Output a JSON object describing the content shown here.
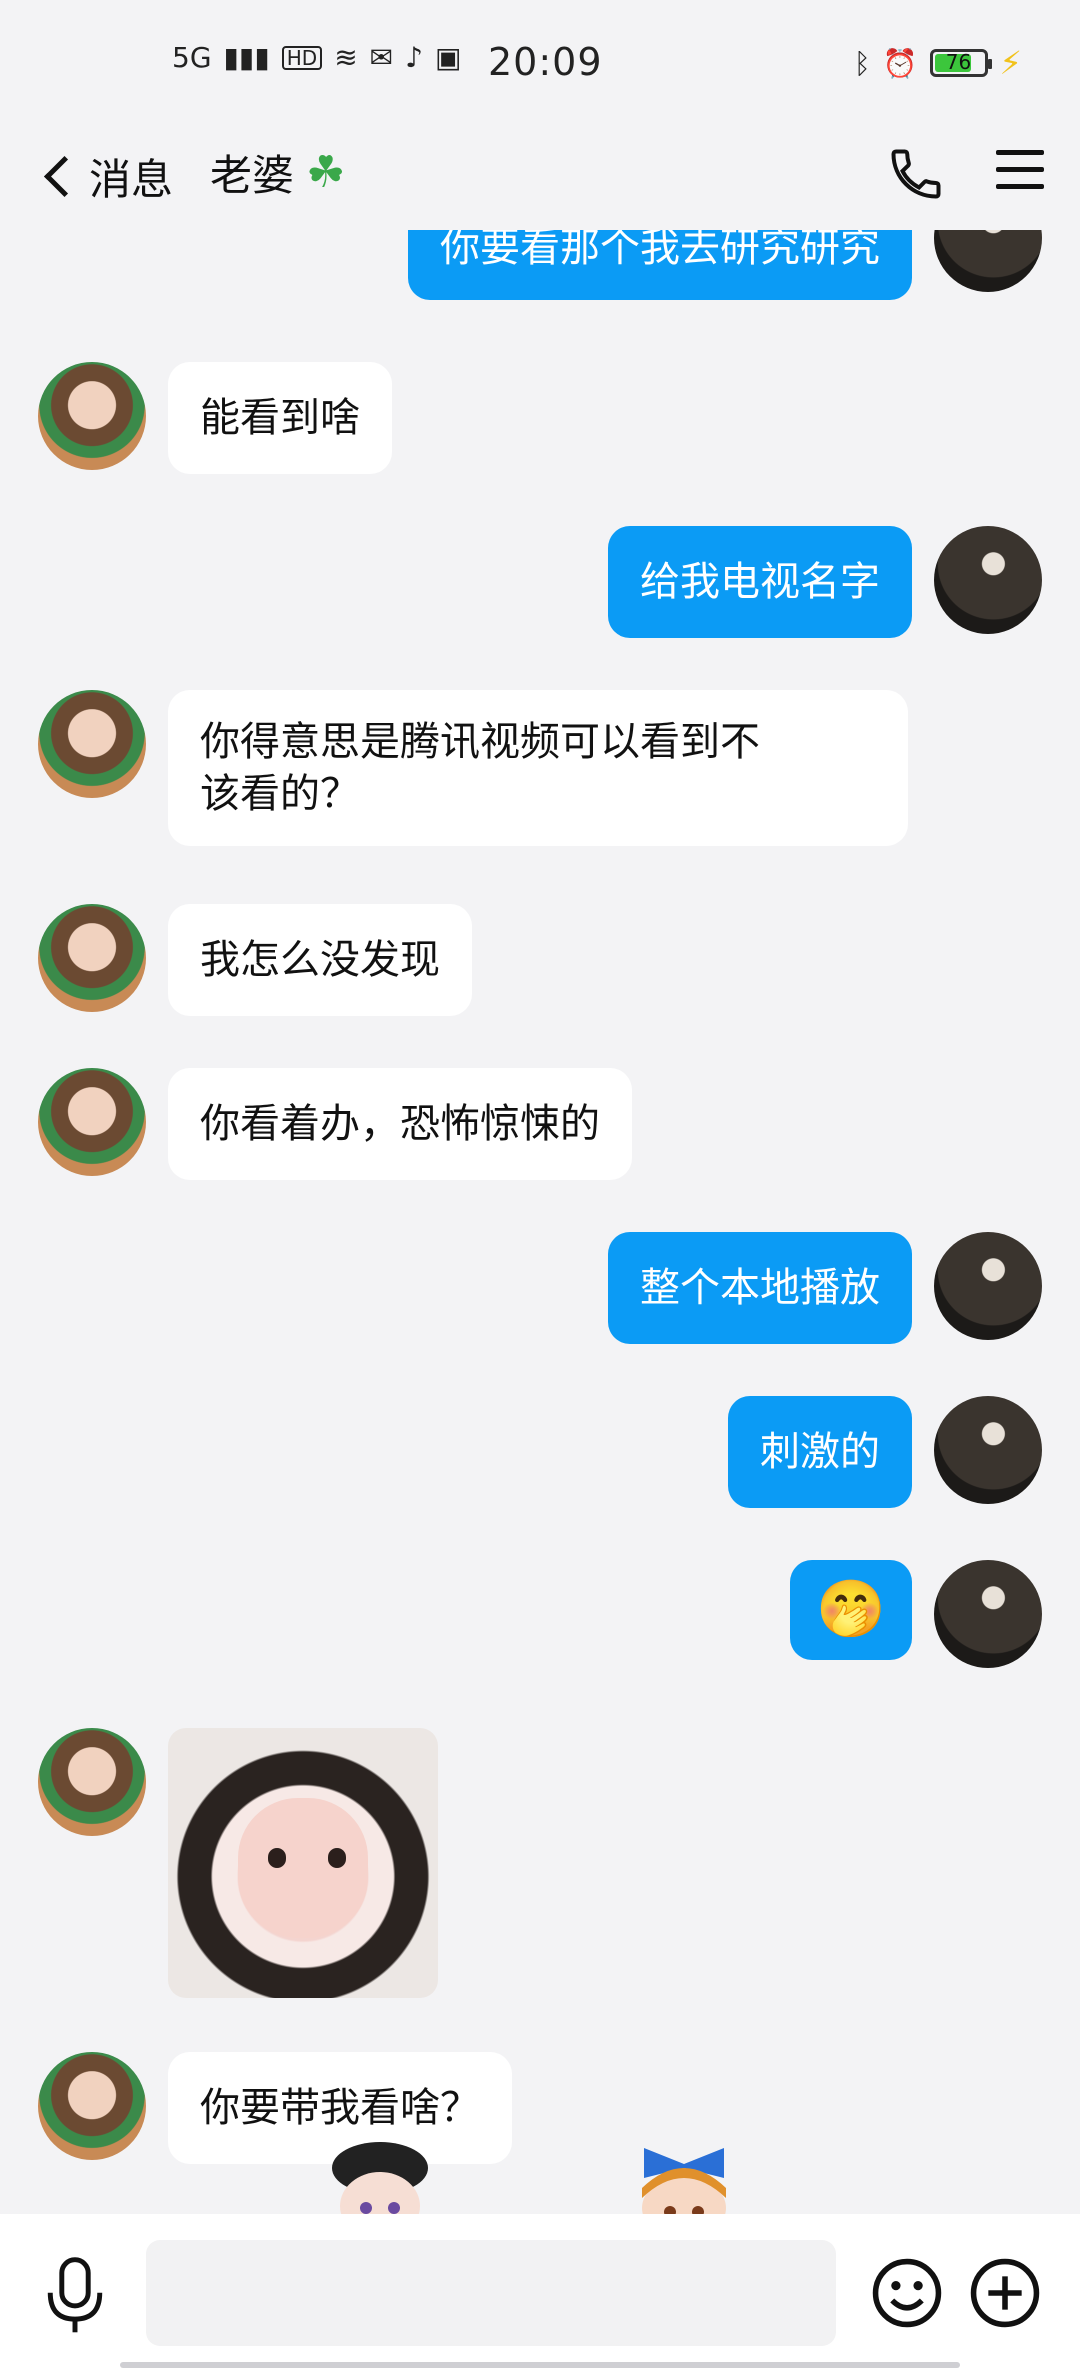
{
  "status_bar": {
    "network": "5G",
    "hd": "HD",
    "time": "20:09",
    "battery": "76",
    "battery_level": 0.76
  },
  "header": {
    "back_label": "消息",
    "title": "老婆",
    "title_emoji": "☘",
    "icons": [
      "back-chevron-icon",
      "phone-icon",
      "menu-icon"
    ]
  },
  "messages": [
    {
      "from": "me",
      "text": "你要看那个我去研究研究"
    },
    {
      "from": "her",
      "text": "能看到啥"
    },
    {
      "from": "me",
      "text": "给我电视名字"
    },
    {
      "from": "her",
      "text": "你得意思是腾讯视频可以看到不\n该看的？"
    },
    {
      "from": "her",
      "text": "我怎么没发现"
    },
    {
      "from": "her",
      "text": "你看着办，恐怖惊悚的"
    },
    {
      "from": "me",
      "text": "整个本地播放"
    },
    {
      "from": "me",
      "text": "刺激的"
    },
    {
      "from": "me",
      "text": "🤭"
    },
    {
      "from": "her",
      "type": "image"
    },
    {
      "from": "her",
      "text": "你要带我看啥？"
    }
  ],
  "bottom_bar": {
    "icons": [
      "microphone-icon",
      "emoji-icon",
      "plus-icon"
    ],
    "input_value": ""
  },
  "colors": {
    "outgoing_bubble": "#0b9bf5",
    "incoming_bubble": "#ffffff",
    "background": "#f3f3f5"
  }
}
